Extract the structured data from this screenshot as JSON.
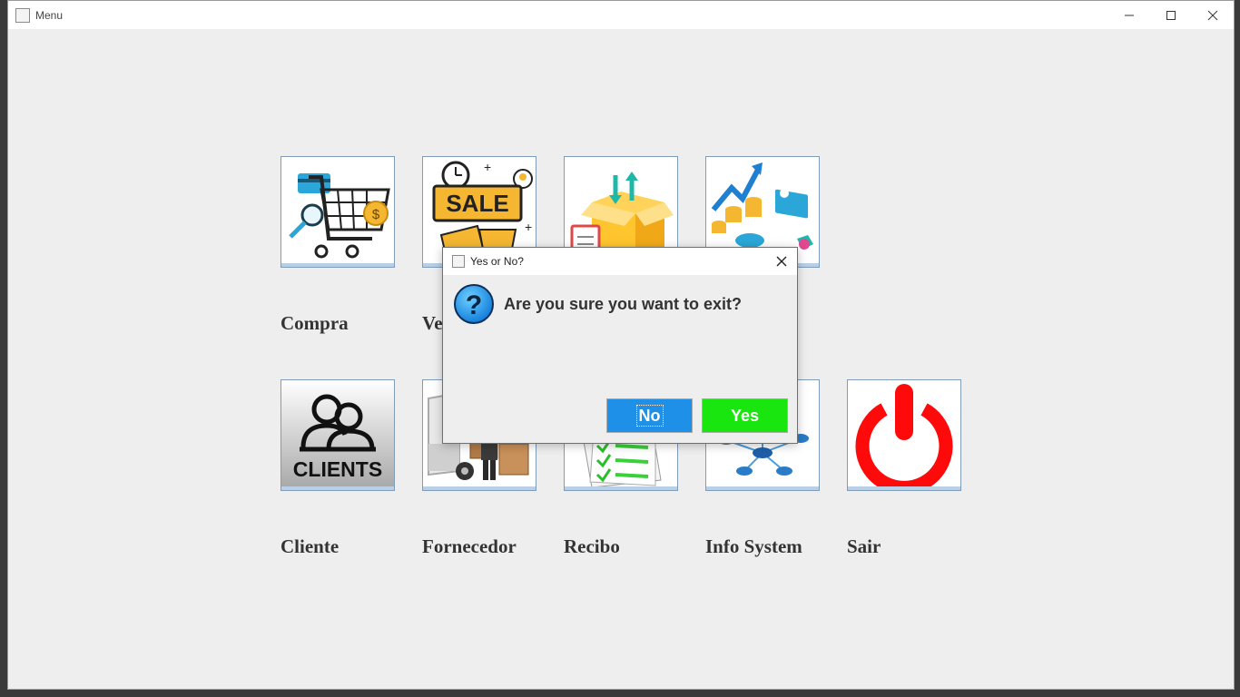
{
  "window": {
    "title": "Menu"
  },
  "tiles": {
    "compra": {
      "label": "Compra",
      "icon": "shopping-cart-icon"
    },
    "venda": {
      "label": "Ve",
      "icon": "sale-icon"
    },
    "estoque": {
      "icon": "inventory-box-icon"
    },
    "financeiro": {
      "icon": "finance-chart-icon"
    },
    "cliente": {
      "label": "Cliente",
      "icon": "clients-icon",
      "icon_text": "CLIENTS"
    },
    "fornecedor": {
      "label": "Fornecedor",
      "icon": "delivery-truck-icon"
    },
    "recibo": {
      "label": "Recibo",
      "icon": "receipt-document-icon"
    },
    "info": {
      "label": "Info System",
      "icon": "network-icon"
    },
    "sair": {
      "label": "Sair",
      "icon": "power-icon"
    }
  },
  "dialog": {
    "title": "Yes or No?",
    "message": "Are you sure you want to exit?",
    "no_label": "No",
    "yes_label": "Yes",
    "icon": "question-icon"
  },
  "colors": {
    "no_button": "#1e90e8",
    "yes_button": "#19e60f",
    "power_red": "#ff0a0a",
    "sale_yellow": "#f5b731"
  }
}
